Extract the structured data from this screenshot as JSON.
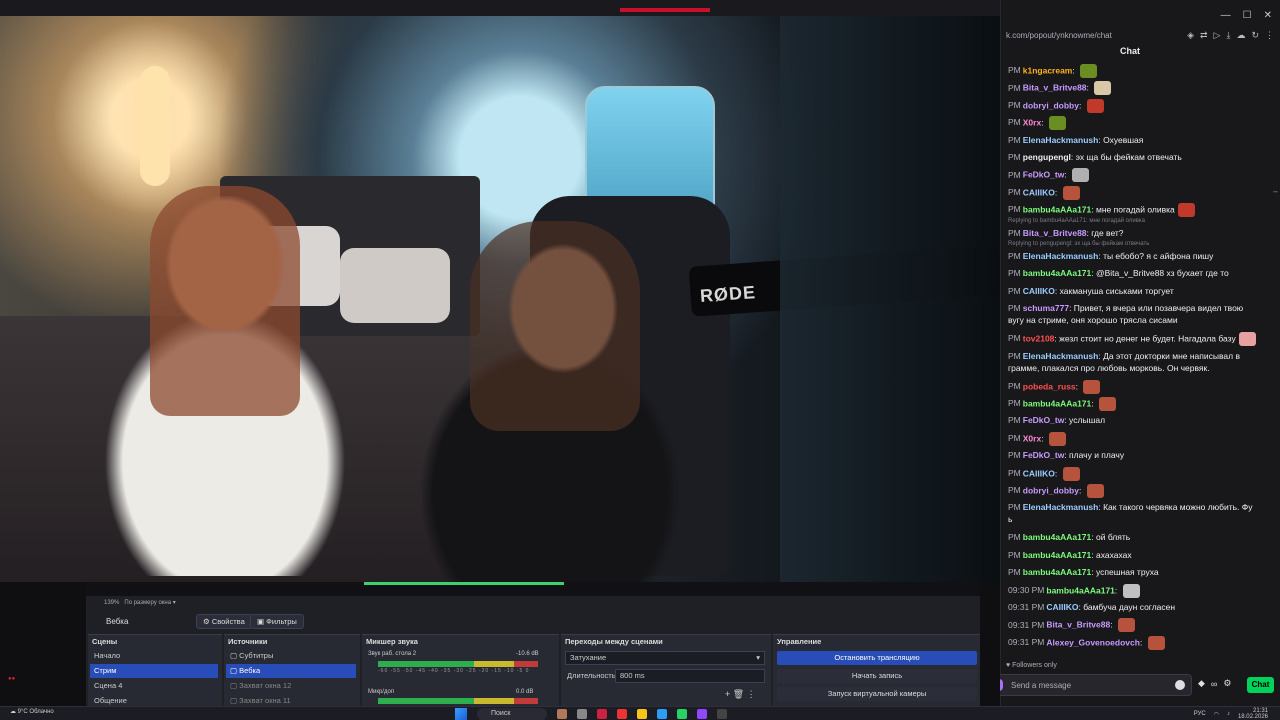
{
  "chat": {
    "url": "k.com/popout/ynknowme/chat",
    "title": "Chat",
    "followers_only": "Followers only",
    "placeholder": "Send a message",
    "chat_button": "Chat",
    "messages": [
      {
        "time": "PM",
        "user": "k1ngacream",
        "color": "#ffb31a",
        "text": "",
        "emote": "#6b8e23"
      },
      {
        "time": "PM",
        "user": "Bita_v_Britve88",
        "color": "#c79bff",
        "text": "",
        "emote": "#d8c8a8"
      },
      {
        "time": "PM",
        "user": "dobryi_dobby",
        "color": "#c79bff",
        "text": "",
        "emote": "#c0392b"
      },
      {
        "time": "PM",
        "user": "X0rx",
        "color": "#ff8ad8",
        "text": "",
        "emote": "#6b8e23"
      },
      {
        "time": "PM",
        "user": "ElenaHackmanush",
        "color": "#9acdff",
        "text": "Охуевшая"
      },
      {
        "time": "PM",
        "user": "pengupengl",
        "color": "#efeff1",
        "text": "эх ща бы фейкам отвечать"
      },
      {
        "time": "PM",
        "user": "FeDkO_tw",
        "color": "#c79bff",
        "text": "",
        "emote": "#b0b0b0"
      },
      {
        "time": "PM",
        "user": "CAIIIKO",
        "color": "#9acdff",
        "text": "",
        "emote": "#b5533c"
      },
      {
        "time": "PM",
        "user": "bambu4aAAa171",
        "color": "#7cfc7c",
        "text": "мне погадай оливка",
        "emote": "#c0392b"
      },
      {
        "reply": "Replying to bambu4aAAa171: мне погадай оливка",
        "time": "PM",
        "user": "Bita_v_Britve88",
        "color": "#c79bff",
        "text": "где вет?"
      },
      {
        "reply": "Replying to pengupengl: эх ща бы фейкам отвечать",
        "time": "PM",
        "user": "ElenaHackmanush",
        "color": "#9acdff",
        "text": "ты ебобо? я с айфона пишу"
      },
      {
        "time": "PM",
        "user": "bambu4aAAa171",
        "color": "#7cfc7c",
        "text": "@Bita_v_Britve88 хз бухает где то"
      },
      {
        "time": "PM",
        "user": "CAIIIKO",
        "color": "#9acdff",
        "text": "хакманушa сиськами торгует"
      },
      {
        "time": "PM",
        "user": "schuma777",
        "color": "#c79bff",
        "text": "Привет, я вчера или позавчера видел твою",
        "text2": "вугу на стриме, оня хорошо трясла сисами"
      },
      {
        "time": "PM",
        "user": "tov2108",
        "color": "#ff4f4f",
        "text": "жезл стоит но денег не будет. Нагадала базу",
        "emote": "#e8a0a0"
      },
      {
        "time": "PM",
        "user": "ElenaHackmanush",
        "color": "#9acdff",
        "text": "Да этот докторки мне написывал в",
        "text2": "грамме, плакался про любовь морковь. Он червяк."
      },
      {
        "time": "PM",
        "user": "pobeda_russ",
        "color": "#ff4f4f",
        "text": "",
        "emote": "#b5533c"
      },
      {
        "time": "PM",
        "user": "bambu4aAAa171",
        "color": "#7cfc7c",
        "text": "",
        "emote": "#b5533c"
      },
      {
        "time": "PM",
        "user": "FeDkO_tw",
        "color": "#c79bff",
        "text": "услышал"
      },
      {
        "time": "PM",
        "user": "X0rx",
        "color": "#ff8ad8",
        "text": "",
        "emote": "#b5533c"
      },
      {
        "time": "PM",
        "user": "FeDkO_tw",
        "color": "#c79bff",
        "text": "плачу и плачу"
      },
      {
        "time": "PM",
        "user": "CAIIIKO",
        "color": "#9acdff",
        "text": "",
        "emote": "#b5533c"
      },
      {
        "time": "PM",
        "user": "dobryi_dobby",
        "color": "#c79bff",
        "text": "",
        "emote": "#b5533c"
      },
      {
        "time": "PM",
        "user": "ElenaHackmanush",
        "color": "#9acdff",
        "text": "Как такого червяка можно любить. Фу",
        "text2": "ь"
      },
      {
        "time": "PM",
        "user": "bambu4aAAa171",
        "color": "#7cfc7c",
        "text": "ой блять"
      },
      {
        "time": "PM",
        "user": "bambu4aAAa171",
        "color": "#7cfc7c",
        "text": "ахахахах"
      },
      {
        "time": "PM",
        "user": "bambu4aAAa171",
        "color": "#7cfc7c",
        "text": "успешная труха"
      },
      {
        "time": "09:30 PM",
        "user": "bambu4aAAa171",
        "color": "#7cfc7c",
        "text": "",
        "emote": "#c0c0c0"
      },
      {
        "time": "09:31 PM",
        "user": "CAIIIKO",
        "color": "#9acdff",
        "text": "бамбуча даун согласен"
      },
      {
        "time": "09:31 PM",
        "user": "Bita_v_Britve88",
        "color": "#c79bff",
        "text": "",
        "emote": "#b5533c"
      },
      {
        "time": "09:31 PM",
        "user": "Alexey_Govenoedovch",
        "color": "#c79bff",
        "text": "",
        "emote": "#b5533c"
      }
    ]
  },
  "video": {
    "mic_label": "RØDE"
  },
  "obs": {
    "zoom": "139%",
    "fit": "По размеру окна",
    "selected_source": "Вебка",
    "properties_btn": "Свойства",
    "filters_btn": "Фильтры",
    "scenes_header": "Сцены",
    "scenes": [
      "Начало",
      "Стрим",
      "Сцена 4",
      "Общение"
    ],
    "sources_header": "Источники",
    "sources": [
      "Субтитры",
      "Вебка",
      "Захват окна 12",
      "Захват окна 11"
    ],
    "mixer_header": "Микшер звука",
    "mixer": [
      {
        "name": "Звук раб. стола 2",
        "db": "-10.6 dB"
      },
      {
        "name": "Микр/доп",
        "db": "0.0 dB"
      }
    ],
    "mixer_scale": "-60 -55 -50 -45 -40 -35 -30 -25 -20 -15 -10 -5 0",
    "transitions_header": "Переходы между сценами",
    "transition": "Затухание",
    "duration_label": "Длительность",
    "duration": "800 ms",
    "controls_header": "Управление",
    "controls": [
      "Остановить трансляцию",
      "Начать запись",
      "Запуск виртуальной камеры"
    ]
  },
  "taskbar": {
    "weather_temp": "9°C",
    "weather_desc": "Облачно",
    "search": "Поиск",
    "lang": "РУС",
    "time": "21:31",
    "date": "18.02.2026"
  }
}
